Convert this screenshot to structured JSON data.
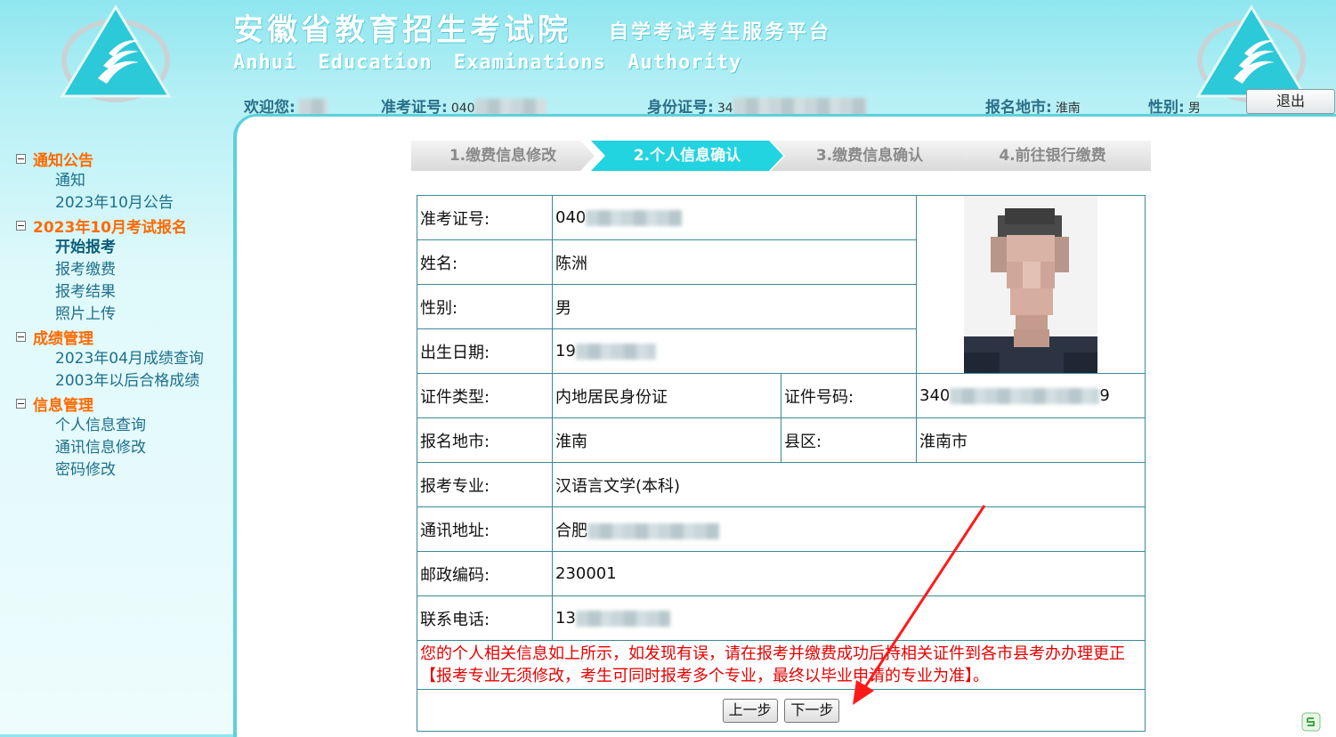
{
  "header": {
    "title_cn": "安徽省教育招生考试院",
    "subtitle_cn": "自学考试考生服务平台",
    "title_en": "Anhui Education Examinations Authority"
  },
  "userbar": {
    "welcome_label": "欢迎您:",
    "welcome_value": "",
    "exam_no_label": "准考证号:",
    "exam_no_value": "040",
    "id_label": "身份证号:",
    "id_value": "34",
    "city_label": "报名地市:",
    "city_value": "淮南",
    "gender_label": "性别:",
    "gender_value": "男",
    "logout": "退出"
  },
  "sidebar": {
    "groups": [
      {
        "title": "通知公告",
        "items": [
          "通知",
          "2023年10月公告"
        ]
      },
      {
        "title": "2023年10月考试报名",
        "items": [
          "开始报考",
          "报考缴费",
          "报考结果",
          "照片上传"
        ]
      },
      {
        "title": "成绩管理",
        "items": [
          "2023年04月成绩查询",
          "2003年以后合格成绩"
        ]
      },
      {
        "title": "信息管理",
        "items": [
          "个人信息查询",
          "通讯信息修改",
          "密码修改"
        ]
      }
    ],
    "active_item": "开始报考"
  },
  "steps": [
    {
      "label": "1.缴费信息修改"
    },
    {
      "label": "2.个人信息确认"
    },
    {
      "label": "3.缴费信息确认"
    },
    {
      "label": "4.前往银行缴费"
    }
  ],
  "active_step": 2,
  "form": {
    "exam_no_label": "准考证号:",
    "exam_no": "040",
    "name_label": "姓名:",
    "name": "陈洲",
    "gender_label": "性别:",
    "gender": "男",
    "birth_label": "出生日期:",
    "birth": "19",
    "id_type_label": "证件类型:",
    "id_type": "内地居民身份证",
    "id_no_label": "证件号码:",
    "id_no": "340",
    "id_no_suffix": "9",
    "city_label": "报名地市:",
    "city": "淮南",
    "county_label": "县区:",
    "county": "淮南市",
    "major_label": "报考专业:",
    "major": "汉语言文学(本科)",
    "address_label": "通讯地址:",
    "address": "合肥",
    "postcode_label": "邮政编码:",
    "postcode": "230001",
    "phone_label": "联系电话:",
    "phone": "13",
    "notice": "您的个人相关信息如上所示，如发现有误，请在报考并缴费成功后持相关证件到各市县考办办理更正【报考专业无须修改，考生可同时报考多个专业，最终以毕业申请的专业为准】。",
    "prev_button": "上一步",
    "next_button": "下一步"
  },
  "colors": {
    "accent": "#22d3e0",
    "sidebar_group": "#ff6a00",
    "sidebar_item": "#1d6f8a",
    "notice": "#e60000",
    "annotation_arrow": "#ff1a1a"
  }
}
